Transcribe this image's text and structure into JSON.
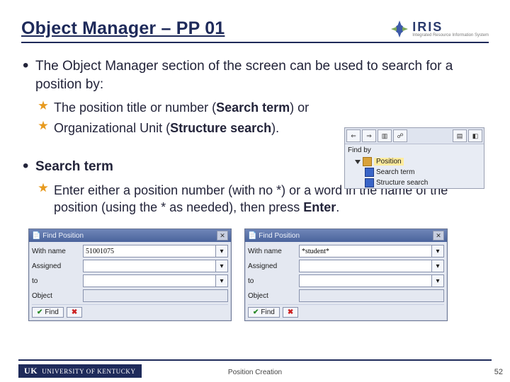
{
  "header": {
    "title": "Object Manager – PP 01",
    "logo": {
      "brand": "IRIS",
      "tagline": "Integrated Resource Information System"
    }
  },
  "bullets": {
    "b1_a": "The Object Manager section of the screen can be used to search for a position by:",
    "b1_sub1_a": "The position title or number (",
    "b1_sub1_bold": "Search term",
    "b1_sub1_b": ") or",
    "b1_sub2_a": "Organizational Unit (",
    "b1_sub2_bold": "Structure search",
    "b1_sub2_b": ").",
    "b2_bold": "Search term",
    "b2_sub1_a": "Enter either a position number (with no *) or a word in the name of the position (using the * as needed), then press ",
    "b2_sub1_bold": "Enter",
    "b2_sub1_b": "."
  },
  "tree": {
    "find_by": "Find by",
    "position": "Position",
    "search_term": "Search term",
    "structure_search": "Structure search"
  },
  "dialog": {
    "title": "Find Position",
    "with_name": "With name",
    "assigned": "Assigned",
    "to": "to",
    "object": "Object",
    "find": "Find",
    "x": "✖",
    "left_value": "51001075",
    "right_value": "*student*"
  },
  "footer": {
    "uk_a": "UK",
    "uk_b": "UNIVERSITY OF KENTUCKY",
    "center": "Position Creation",
    "page": "52"
  }
}
